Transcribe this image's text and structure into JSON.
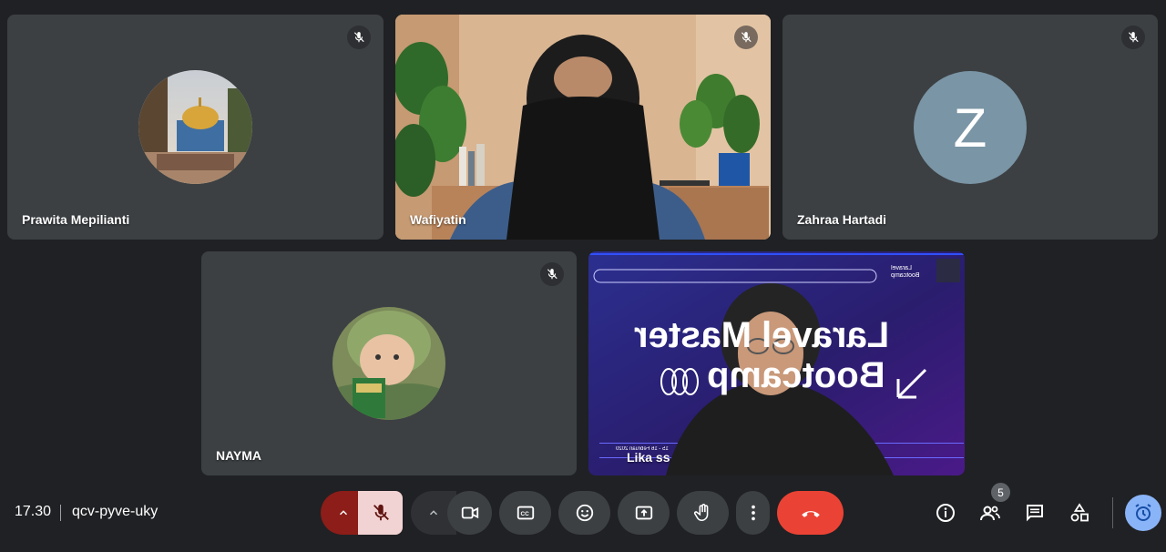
{
  "participants": [
    {
      "name": "Prawita Mepilianti",
      "type": "avatar-photo"
    },
    {
      "name": "Wafiyatin",
      "type": "video"
    },
    {
      "name": "Zahraa Hartadi",
      "type": "initial",
      "initial": "Z",
      "color": "#7a95a5"
    },
    {
      "name": "NAYMA",
      "type": "avatar-photo"
    },
    {
      "name": "Lika ss",
      "type": "video"
    }
  ],
  "slide": {
    "line1": "Laravel Master",
    "line2": "Bootcamp",
    "brand_small": "Laravel Bootcamp",
    "date_small": "15 - 16 Februari 2020"
  },
  "meeting": {
    "time": "17.30",
    "code": "qcv-pyve-uky",
    "people_count": "5"
  },
  "colors": {
    "background": "#202124",
    "tile": "#3c4043",
    "mic_active": "#f2d3d3",
    "mic_dropdown": "#8c1d18",
    "end_call": "#ea4335",
    "host_accent": "#8ab4f8"
  },
  "icons": {
    "mic": "mic-off-icon",
    "camera": "videocam-icon",
    "captions": "closed-caption-icon",
    "reactions": "emoji-icon",
    "present": "present-screen-icon",
    "hand": "raise-hand-icon",
    "more": "more-vert-icon",
    "end": "call-end-icon",
    "info": "info-icon",
    "people": "people-icon",
    "chat": "chat-icon",
    "activities": "activities-icon",
    "host": "host-controls-icon"
  }
}
